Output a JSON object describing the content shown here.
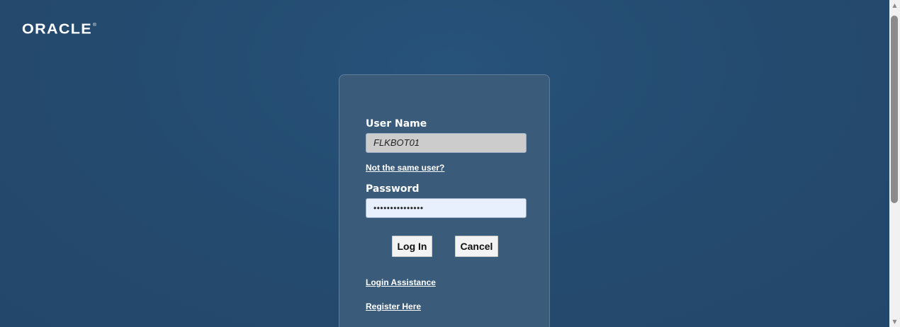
{
  "brand": {
    "logo_text": "ORACLE",
    "logo_mark": "®"
  },
  "login": {
    "username_label": "User Name",
    "username_value": "FLKBOT01",
    "not_same_user_link": "Not the same user?",
    "password_label": "Password",
    "password_value": "•••••••••••••••",
    "login_button": "Log In",
    "cancel_button": "Cancel",
    "login_assistance_link": "Login Assistance",
    "register_link": "Register Here"
  },
  "scrollbar": {
    "up_arrow_icon": "▲",
    "down_arrow_icon": "▼"
  },
  "colors": {
    "background": "#244a6e",
    "panel": "#3a5b79",
    "username_field": "#cccccc",
    "password_field": "#e8f0fe"
  }
}
